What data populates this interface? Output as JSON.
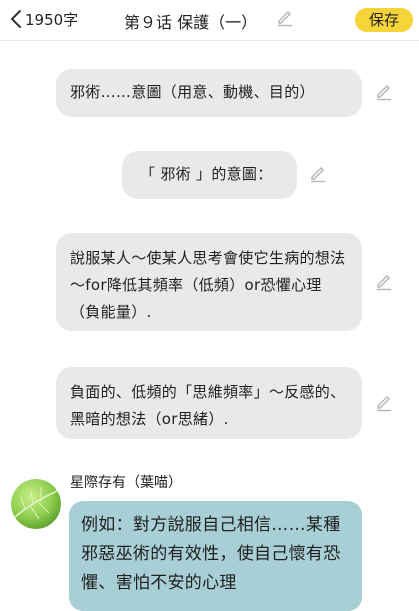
{
  "header": {
    "word_count": "1950字",
    "title": "第９话 保護（一）",
    "save_label": "保存"
  },
  "messages": [
    {
      "text": "邪術……意圖（用意、動機、目的）"
    },
    {
      "text": "「 邪術 」的意圖："
    },
    {
      "text": "說服某人～使某人思考會使它生病的想法～for降低其頻率（低頻）or恐懼心理（負能量）."
    },
    {
      "text": "負面的、低頻的「思維頻率」～反感的、黑暗的想法（or思緒）."
    }
  ],
  "incoming": {
    "sender": "星際存有（葉喵）",
    "text": "例如：對方說服自己相信……某種邪惡巫術的有效性，使自己懷有恐懼、害怕不安的心理"
  },
  "colors": {
    "save_button": "#f7d43a",
    "outgoing_bubble": "#e9e9e9",
    "incoming_bubble": "#a9cfd6"
  }
}
